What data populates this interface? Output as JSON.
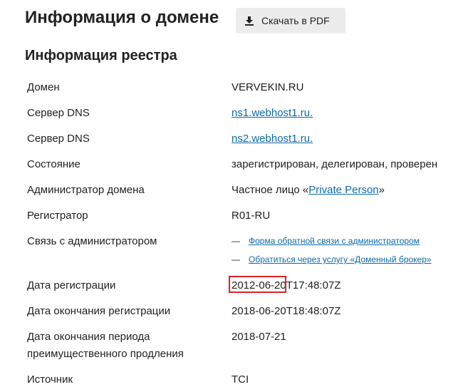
{
  "header": {
    "title": "Информация о домене",
    "pdf_button_label": "Скачать в PDF"
  },
  "section": {
    "title": "Информация реестра"
  },
  "rows": [
    {
      "label": "Домен",
      "value": "VERVEKIN.RU"
    },
    {
      "label": "Сервер DNS",
      "value": "ns1.webhost1.ru."
    },
    {
      "label": "Сервер DNS",
      "value": "ns2.webhost1.ru."
    },
    {
      "label": "Состояние",
      "value": "зарегистрирован, делегирован, проверен"
    },
    {
      "label": "Администратор домена",
      "value_prefix": "Частное лицо «",
      "value_link": "Private Person",
      "value_suffix": "»"
    },
    {
      "label": "Регистратор",
      "value": "R01-RU"
    },
    {
      "label": "Связь с администратором",
      "links": [
        "Форма обратной связи с администратором",
        "Обратиться через услугу «Доменный брокер»"
      ],
      "dash": "—"
    },
    {
      "label": "Дата регистрации",
      "value_date": "2012-06-20",
      "value_time": "T17:48:07Z"
    },
    {
      "label": "Дата окончания регистрации",
      "value": "2018-06-20T18:48:07Z"
    },
    {
      "label_line1": "Дата окончания периода",
      "label_line2": "преимущественного продления",
      "value": "2018-07-21"
    },
    {
      "label": "Источник",
      "value": "TCI"
    }
  ],
  "colors": {
    "link": "#0d6ba8",
    "highlight_border": "#d9232c",
    "button_bg": "#ececec"
  },
  "icons": {
    "pdf_button": "download-icon"
  }
}
